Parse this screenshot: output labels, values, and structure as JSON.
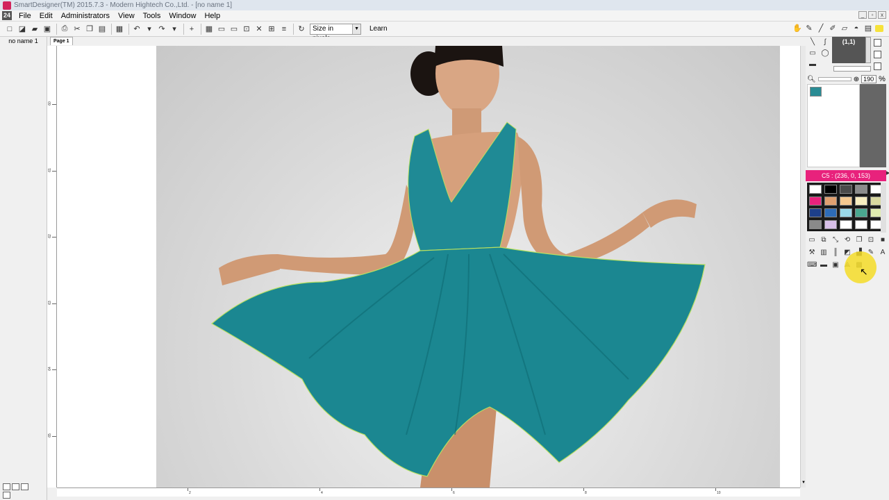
{
  "window": {
    "title": "SmartDesigner(TM) 2015.7.3 - Modern Hightech Co.,Ltd. - [no name 1]",
    "controls": [
      "_",
      "▫",
      "x"
    ]
  },
  "menubar": {
    "logo": "24",
    "items": [
      "File",
      "Edit",
      "Administrators",
      "View",
      "Tools",
      "Window",
      "Help"
    ]
  },
  "toolbar": {
    "size_select": "Size in pixels",
    "learn": "Learn"
  },
  "tabs": {
    "doc_name": "no name 1",
    "page_tab": "Page 1"
  },
  "rulers": {
    "vertical_labels": [
      "60",
      "61",
      "62",
      "63",
      "64",
      "65"
    ],
    "horizontal_labels": [
      "2",
      "4",
      "6",
      "8",
      "10"
    ]
  },
  "right_panel": {
    "preview_label": "(1,1)",
    "zoom_value": "190",
    "color_label": "C5 : (236, 0, 153)",
    "palette": [
      "#ffffff",
      "#000000",
      "#4a4a4a",
      "#8c8c8c",
      "#ffffff",
      "#e8227c",
      "#e0a070",
      "#f4c890",
      "#f8eec0",
      "#d8d8a0",
      "#1d3f8a",
      "#2e6cb8",
      "#9ad8e8",
      "#4aa890",
      "#e0ecb0",
      "#8a8a8a",
      "#d8c0e8",
      "#ffffff",
      "#ffffff",
      "#ffffff"
    ]
  }
}
